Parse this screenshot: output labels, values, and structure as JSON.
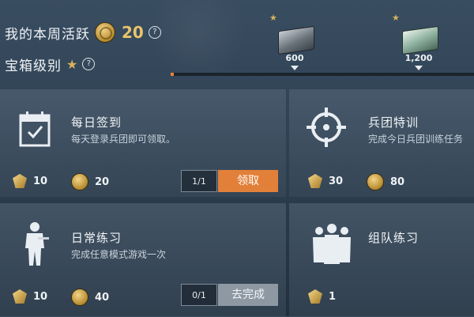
{
  "header": {
    "weekly_active_label": "我的本周活跃",
    "weekly_active_value": "20",
    "chest_level_label": "宝箱级别",
    "help_glyph": "?",
    "milestones": [
      {
        "threshold": "600"
      },
      {
        "threshold": "1,200"
      }
    ],
    "progress_fraction": 0.0
  },
  "tasks": [
    {
      "name": "每日签到",
      "desc": "每天登录兵团即可领取。",
      "reward_a": "10",
      "reward_b": "20",
      "count": "1/1",
      "button": "领取",
      "icon": "calendar-check-icon"
    },
    {
      "name": "兵团特训",
      "desc": "完成今日兵团训练任务",
      "reward_a": "30",
      "reward_b": "80",
      "icon": "crosshair-icon"
    },
    {
      "name": "日常练习",
      "desc": "完成任意模式游戏一次",
      "reward_a": "10",
      "reward_b": "40",
      "count": "0/1",
      "button": "去完成",
      "icon": "soldier-icon"
    },
    {
      "name": "组队练习",
      "reward_a": "1",
      "icon": "squad-icon"
    }
  ],
  "colors": {
    "accent": "#e2803a",
    "gold": "#e9c36b",
    "button_grey": "#8d98a3"
  }
}
